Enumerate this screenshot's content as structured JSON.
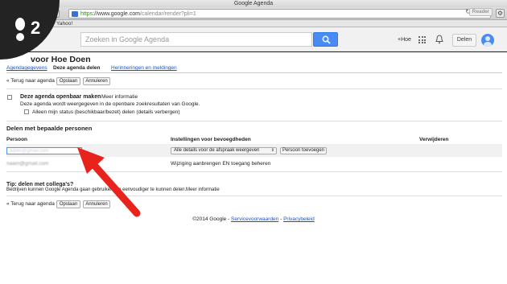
{
  "browser": {
    "window_title": "Google Agenda",
    "url_https": "https",
    "url_host": "://www.google.com",
    "url_path": "/calendar/render?pli=1",
    "reader_label": "Reader",
    "bookmark_yahoo": "Yahoo!"
  },
  "badge": {
    "number": "2"
  },
  "header": {
    "search_placeholder": "Zoeken in Google Agenda",
    "plus_label": "+Hoe",
    "share_label": "Delen",
    "accent_color": "#4a8af4"
  },
  "page": {
    "title": "voor Hoe Doen",
    "tabs": [
      "Agendagegevens",
      "Deze agenda delen",
      "Herinneringen en meldingen"
    ],
    "back_link": "« Terug naar agenda",
    "save_label": "Opslaan",
    "cancel_label": "Annuleren",
    "public": {
      "heading": "Deze agenda openbaar maken",
      "more_info": "Meer informatie",
      "description": "Deze agenda wordt weergegeven in de openbare zoekresultaten van Google.",
      "status_only": "Alleen mijn status (beschikbaar/bezet) delen (details verbergen)"
    },
    "sharing": {
      "heading": "Delen met bepaalde personen",
      "col_person": "Persoon",
      "col_settings": "Instellingen voor bevoegdheden",
      "col_remove": "Verwijderen",
      "input_value": "adres@gmail.com",
      "select_value": "Alle details voor de afspraak weergeven",
      "add_person": "Persoon toevoegen",
      "existing_person": "naam@gmail.com",
      "existing_permission": "Wijziging aanbrengen EN toegang beheren"
    },
    "tip": {
      "heading": "Tip: delen met collega's?",
      "text": "Bedrijven kunnen Google Agenda gaan gebruiken om eenvoudiger te kunnen delen.",
      "link": "Meer informatie"
    },
    "footer": {
      "copyright": "©2014 Google - ",
      "terms": "Servicevoorwaarden",
      "dash": " - ",
      "privacy": "Privacybeleid"
    }
  }
}
